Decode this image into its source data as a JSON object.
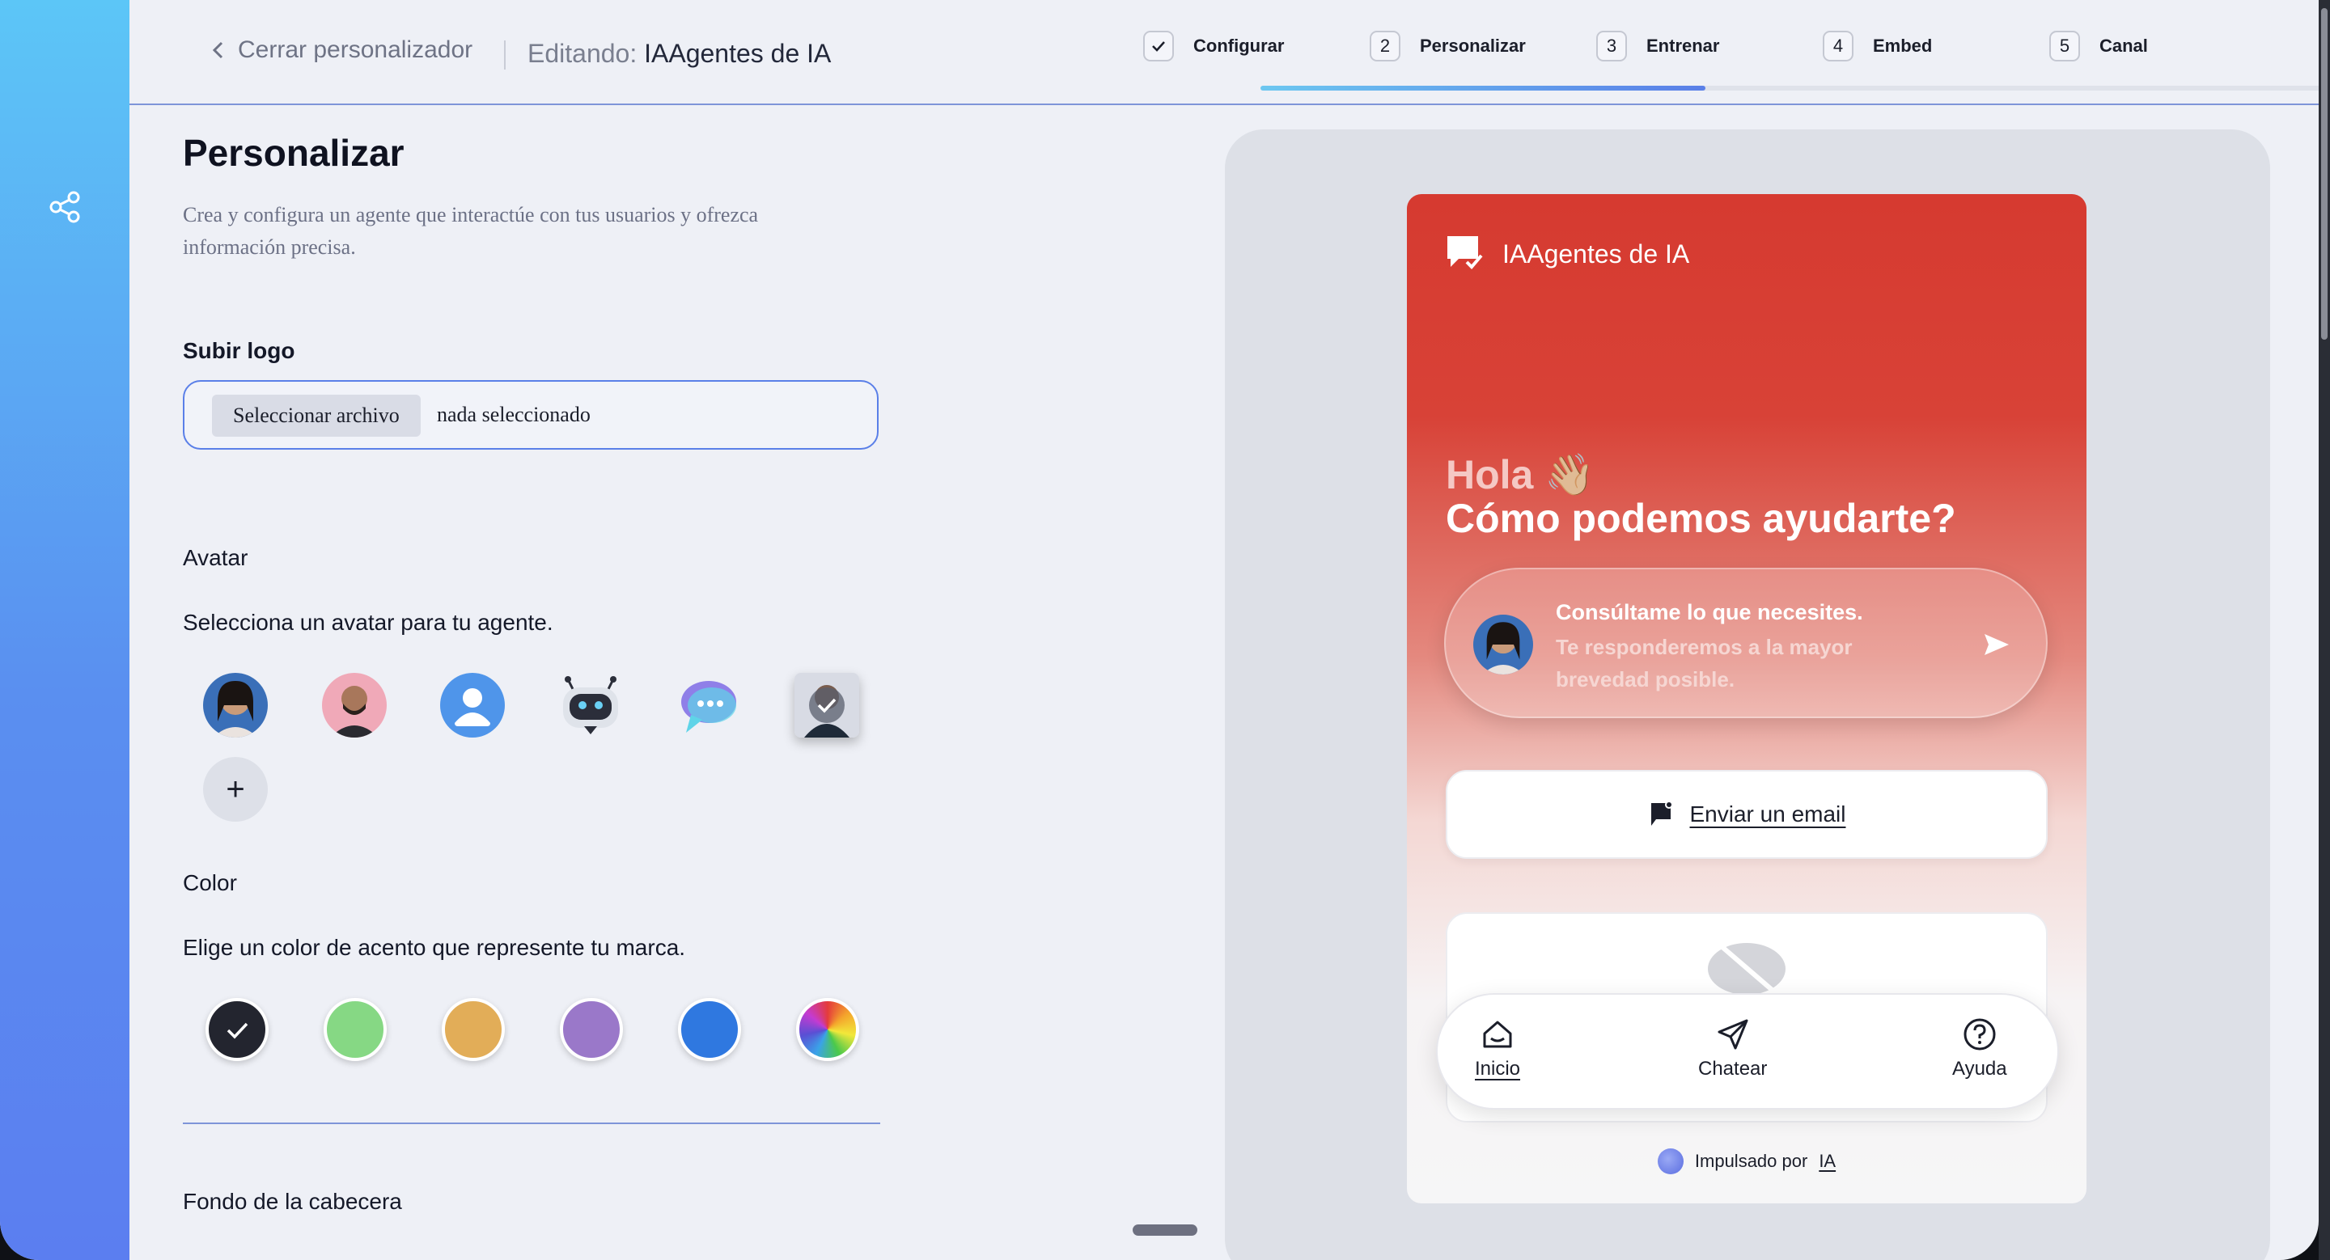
{
  "header": {
    "back_label": "Cerrar personalizador",
    "editing_prefix": "Editando:",
    "editing_name": "IAAgentes de IA"
  },
  "steps": [
    {
      "num": "✓",
      "label": "Configurar",
      "done": true
    },
    {
      "num": "2",
      "label": "Personalizar"
    },
    {
      "num": "3",
      "label": "Entrenar"
    },
    {
      "num": "4",
      "label": "Embed"
    },
    {
      "num": "5",
      "label": "Canal"
    }
  ],
  "progress": 0.4,
  "form": {
    "title": "Personalizar",
    "description": "Crea y configura un agente que interactúe con tus usuarios y ofrezca información precisa.",
    "logo_label": "Subir logo",
    "file_button": "Seleccionar archivo",
    "file_status": "nada seleccionado",
    "avatar_label": "Avatar",
    "avatar_hint": "Selecciona un avatar para tu agente.",
    "add_avatar": "+",
    "color_label": "Color",
    "color_hint": "Elige un color de acento que represente tu marca.",
    "colors": [
      "#23252f",
      "#86d884",
      "#e2ad58",
      "#9a78c9",
      "#2f78e0",
      "rainbow"
    ],
    "selected_color": "#23252f",
    "header_bg_label": "Fondo de la cabecera"
  },
  "widget": {
    "title": "IAAgentes de IA",
    "greeting": "Hola 👋🏼",
    "greeting_sub": "Cómo podemos ayudarte?",
    "consult_title": "Consúltame lo que necesites.",
    "consult_text": "Te responderemos a la mayor brevedad posible.",
    "email_button": "Enviar un email",
    "nav": [
      "Inicio",
      "Chatear",
      "Ayuda"
    ],
    "powered_prefix": "Impulsado por",
    "powered_brand": "IA",
    "accent": "#d63a30"
  },
  "icons": [
    "share-icon",
    "chevron-left-icon",
    "check-icon",
    "chat-logo-icon",
    "send-icon",
    "flag-icon",
    "home-icon",
    "paper-plane-icon",
    "help-icon"
  ]
}
